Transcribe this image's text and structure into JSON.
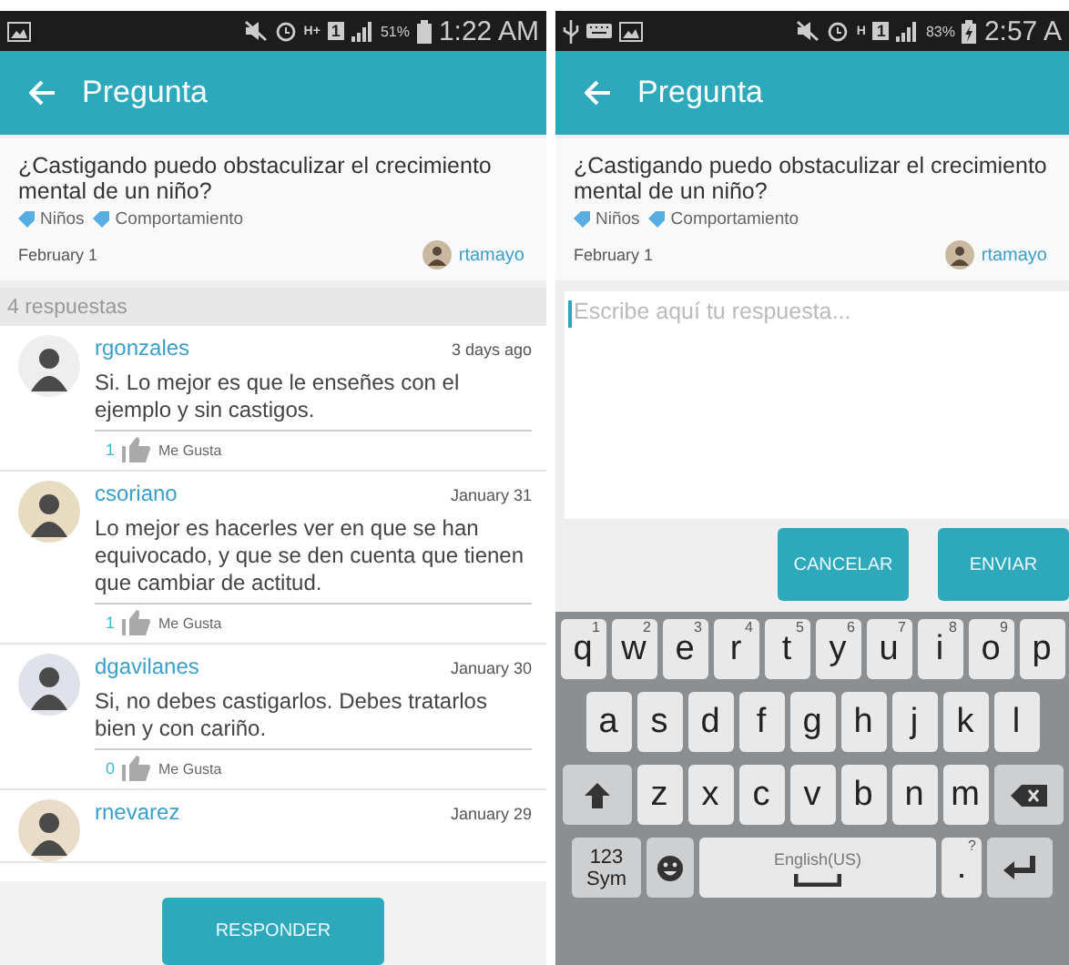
{
  "screens": [
    {
      "status_bar": {
        "left_icons": [
          {
            "kind": "picture"
          }
        ],
        "network": "H+",
        "sim": "1",
        "battery_percent": "51%",
        "battery_charging": false,
        "time": "1:22 AM"
      },
      "app_bar": {
        "title": "Pregunta"
      },
      "question": {
        "text": "¿Castigando puedo obstaculizar el crecimiento mental de un niño?",
        "tags": [
          "Niños",
          "Comportamiento"
        ],
        "date": "February 1",
        "author": "rtamayo"
      },
      "answers_header": "4 respuestas",
      "answers": [
        {
          "user": "rgonzales",
          "date": "3 days ago",
          "text": "Si. Lo mejor es que le enseñes con el ejemplo y sin castigos.",
          "likes": "1",
          "like_label": "Me Gusta"
        },
        {
          "user": "csoriano",
          "date": "January 31",
          "text": "Lo mejor es hacerles ver en que se han equivocado, y que se den cuenta que tienen que cambiar de actitud.",
          "likes": "1",
          "like_label": "Me Gusta"
        },
        {
          "user": "dgavilanes",
          "date": "January 30",
          "text": "Si, no debes castigarlos. Debes tratarlos bien y con cariño.",
          "likes": "0",
          "like_label": "Me Gusta"
        },
        {
          "user": "rnevarez",
          "date": "January 29"
        }
      ],
      "button": "RESPONDER"
    },
    {
      "status_bar": {
        "left_icons": [
          {
            "kind": "usb"
          },
          {
            "kind": "keyboard"
          },
          {
            "kind": "picture"
          }
        ],
        "network": "H",
        "sim": "1",
        "battery_percent": "83%",
        "battery_charging": true,
        "time": "2:57 A"
      },
      "app_bar": {
        "title": "Pregunta"
      },
      "question": {
        "text": "¿Castigando puedo obstaculizar el crecimiento mental de un niño?",
        "tags": [
          "Niños",
          "Comportamiento"
        ],
        "date": "February 1",
        "author": "rtamayo"
      },
      "reply_field": {
        "placeholder": "Escribe aquí tu respuesta..."
      },
      "buttons": [
        "CANCELAR",
        "ENVIAR"
      ],
      "keyboard": {
        "rows": [
          {
            "keys": [
              {
                "kind": "letter",
                "label": "q",
                "hint": "1"
              },
              {
                "kind": "letter",
                "label": "w",
                "hint": "2"
              },
              {
                "kind": "letter",
                "label": "e",
                "hint": "3"
              },
              {
                "kind": "letter",
                "label": "r",
                "hint": "4"
              },
              {
                "kind": "letter",
                "label": "t",
                "hint": "5"
              },
              {
                "kind": "letter",
                "label": "y",
                "hint": "6"
              },
              {
                "kind": "letter",
                "label": "u",
                "hint": "7"
              },
              {
                "kind": "letter",
                "label": "i",
                "hint": "8"
              },
              {
                "kind": "letter",
                "label": "o",
                "hint": "9"
              },
              {
                "kind": "letter",
                "label": "p"
              }
            ]
          },
          {
            "keys": [
              {
                "kind": "letter",
                "label": "a"
              },
              {
                "kind": "letter",
                "label": "s"
              },
              {
                "kind": "letter",
                "label": "d"
              },
              {
                "kind": "letter",
                "label": "f"
              },
              {
                "kind": "letter",
                "label": "g"
              },
              {
                "kind": "letter",
                "label": "h"
              },
              {
                "kind": "letter",
                "label": "j"
              },
              {
                "kind": "letter",
                "label": "k"
              },
              {
                "kind": "letter",
                "label": "l"
              }
            ]
          },
          {
            "keys": [
              {
                "kind": "shift"
              },
              {
                "kind": "letter",
                "label": "z"
              },
              {
                "kind": "letter",
                "label": "x"
              },
              {
                "kind": "letter",
                "label": "c"
              },
              {
                "kind": "letter",
                "label": "v"
              },
              {
                "kind": "letter",
                "label": "b"
              },
              {
                "kind": "letter",
                "label": "n"
              },
              {
                "kind": "letter",
                "label": "m"
              },
              {
                "kind": "backspace"
              }
            ]
          },
          {
            "keys": [
              {
                "kind": "symbols",
                "label": "123 Sym"
              },
              {
                "kind": "emoji"
              },
              {
                "kind": "space",
                "label": "English(US)"
              },
              {
                "kind": "period",
                "label": ".",
                "hint": "?"
              },
              {
                "kind": "enter"
              }
            ]
          }
        ]
      }
    }
  ]
}
